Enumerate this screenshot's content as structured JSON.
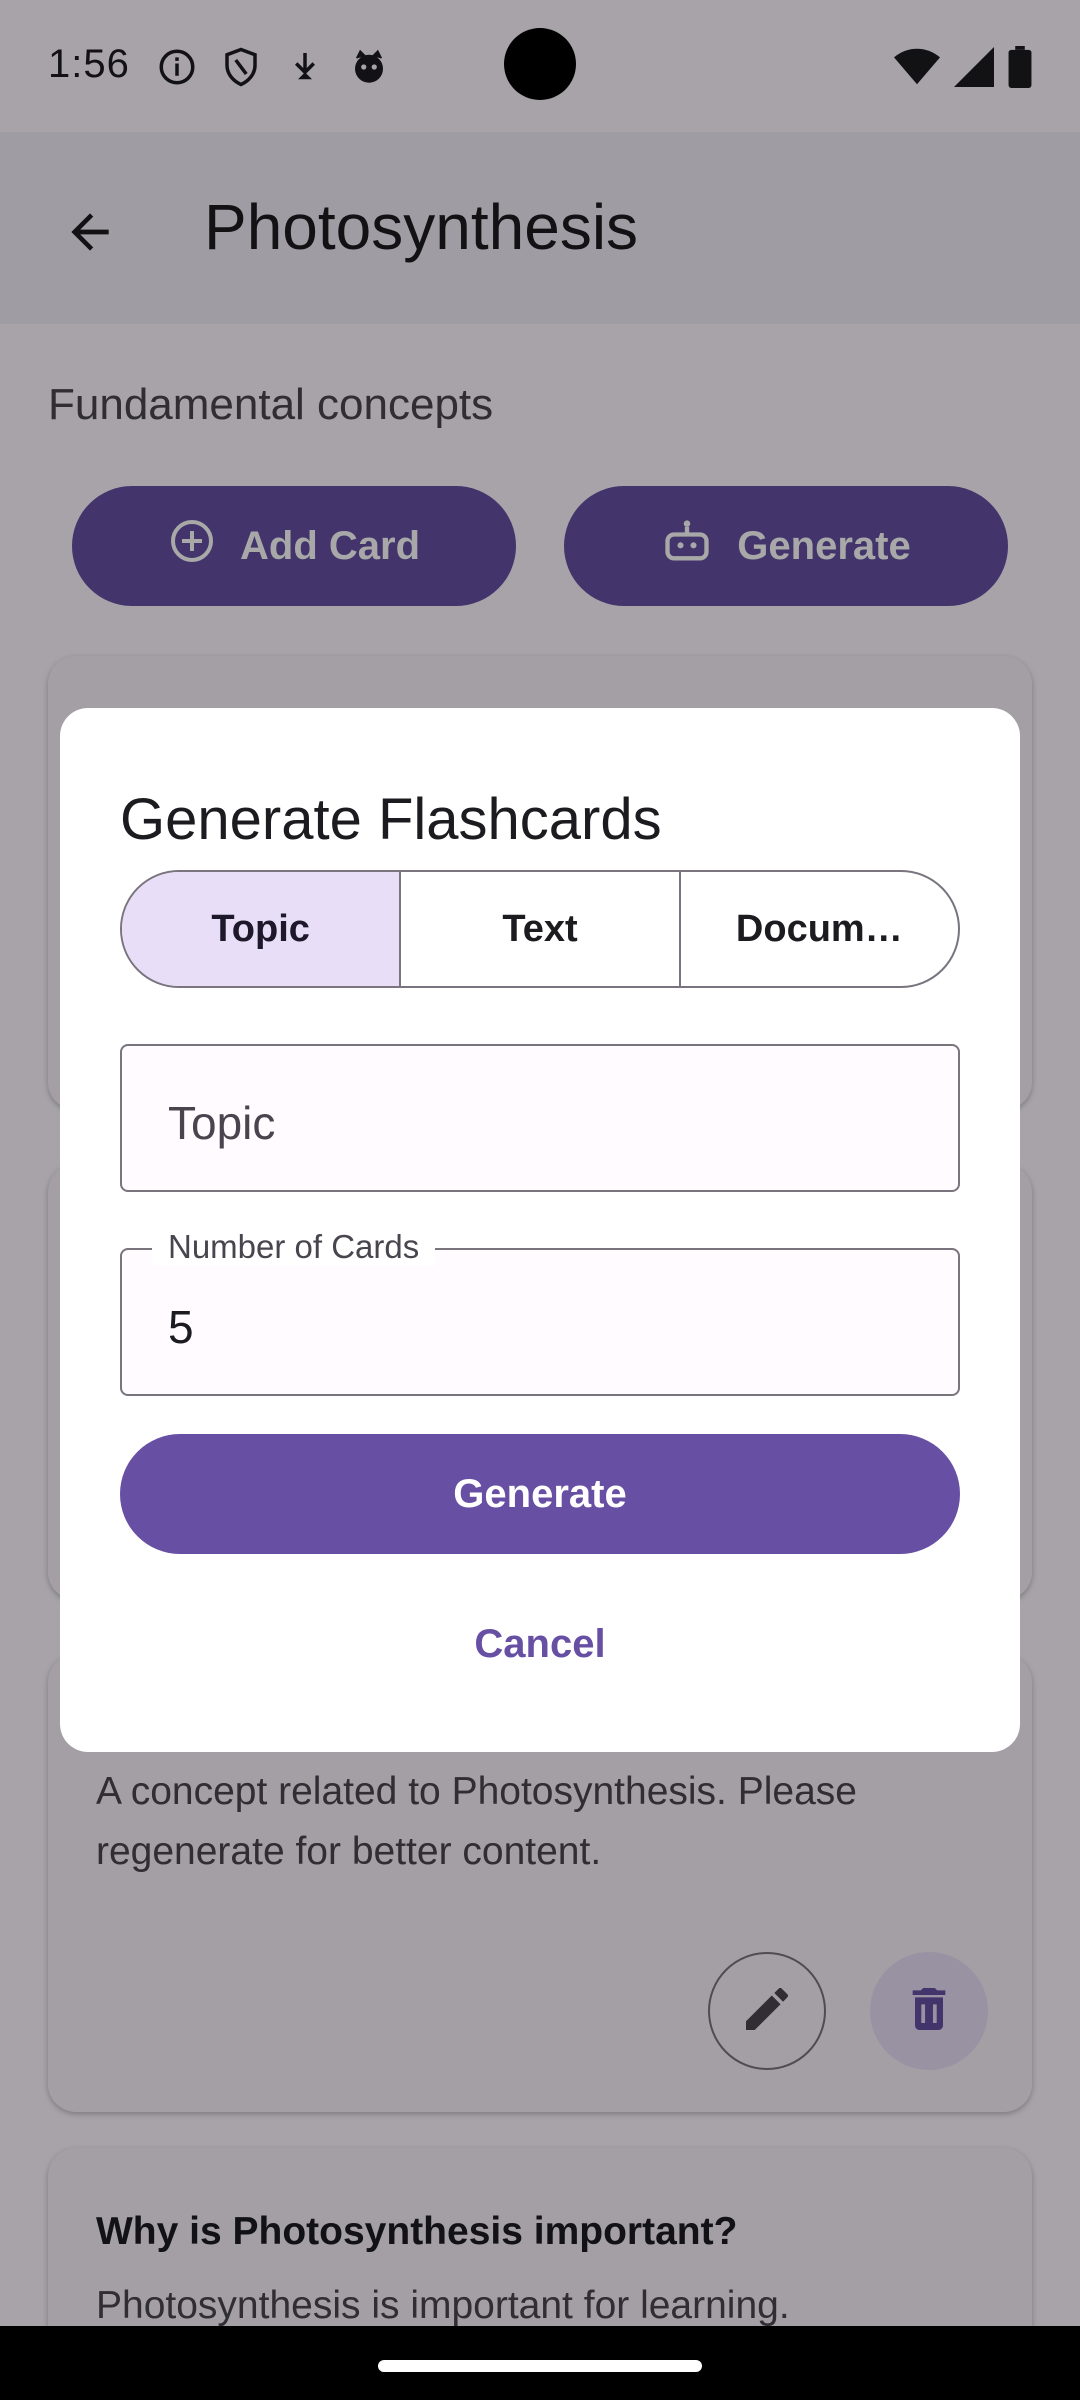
{
  "status_bar": {
    "time": "1:56",
    "left_icons": [
      "info-icon",
      "shield-icon",
      "download-icon",
      "cat-face-icon"
    ],
    "right_icons": [
      "wifi-icon",
      "signal-icon",
      "battery-icon"
    ]
  },
  "app_bar": {
    "title": "Photosynthesis",
    "back_icon": "arrow-back-icon"
  },
  "deck": {
    "section_title": "Fundamental concepts",
    "add_card_label": "Add Card",
    "generate_label": "Generate"
  },
  "cards": [
    {
      "question": "",
      "answer": "A concept related to Photosynthesis. Please regenerate for better content."
    },
    {
      "question": "Why is Photosynthesis important?",
      "answer": "Photosynthesis is important for learning."
    }
  ],
  "dialog": {
    "title": "Generate Flashcards",
    "segments": [
      "Topic",
      "Text",
      "Docum…"
    ],
    "selected_segment": "Topic",
    "topic_placeholder": "Topic",
    "cards_label": "Number of Cards",
    "cards_value": "5",
    "generate_label": "Generate",
    "cancel_label": "Cancel"
  },
  "colors": {
    "primary": "#6750a4",
    "secondary_container": "#e8def8",
    "surface": "#fdf8ff",
    "outline": "#79747e"
  }
}
